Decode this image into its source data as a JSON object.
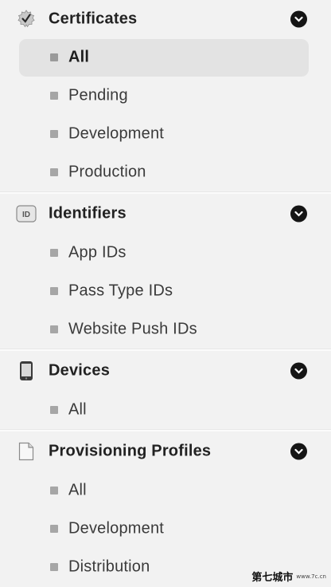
{
  "sections": [
    {
      "id": "certificates",
      "title": "Certificates",
      "icon": "certificate-seal-icon",
      "items": [
        {
          "label": "All",
          "selected": true
        },
        {
          "label": "Pending",
          "selected": false
        },
        {
          "label": "Development",
          "selected": false
        },
        {
          "label": "Production",
          "selected": false
        }
      ]
    },
    {
      "id": "identifiers",
      "title": "Identifiers",
      "icon": "id-badge-icon",
      "icon_text": "ID",
      "items": [
        {
          "label": "App IDs",
          "selected": false
        },
        {
          "label": "Pass Type IDs",
          "selected": false
        },
        {
          "label": "Website Push IDs",
          "selected": false
        }
      ]
    },
    {
      "id": "devices",
      "title": "Devices",
      "icon": "device-phone-icon",
      "items": [
        {
          "label": "All",
          "selected": false
        }
      ]
    },
    {
      "id": "provisioning",
      "title": "Provisioning Profiles",
      "icon": "document-icon",
      "items": [
        {
          "label": "All",
          "selected": false
        },
        {
          "label": "Development",
          "selected": false
        },
        {
          "label": "Distribution",
          "selected": false
        }
      ]
    }
  ],
  "watermark": {
    "chinese": "第七城市",
    "url": "www.7c.cn"
  },
  "colors": {
    "background": "#f2f2f2",
    "selected_bg": "#e3e3e3",
    "bullet": "#a6a6a6",
    "chevron": "#151515"
  }
}
